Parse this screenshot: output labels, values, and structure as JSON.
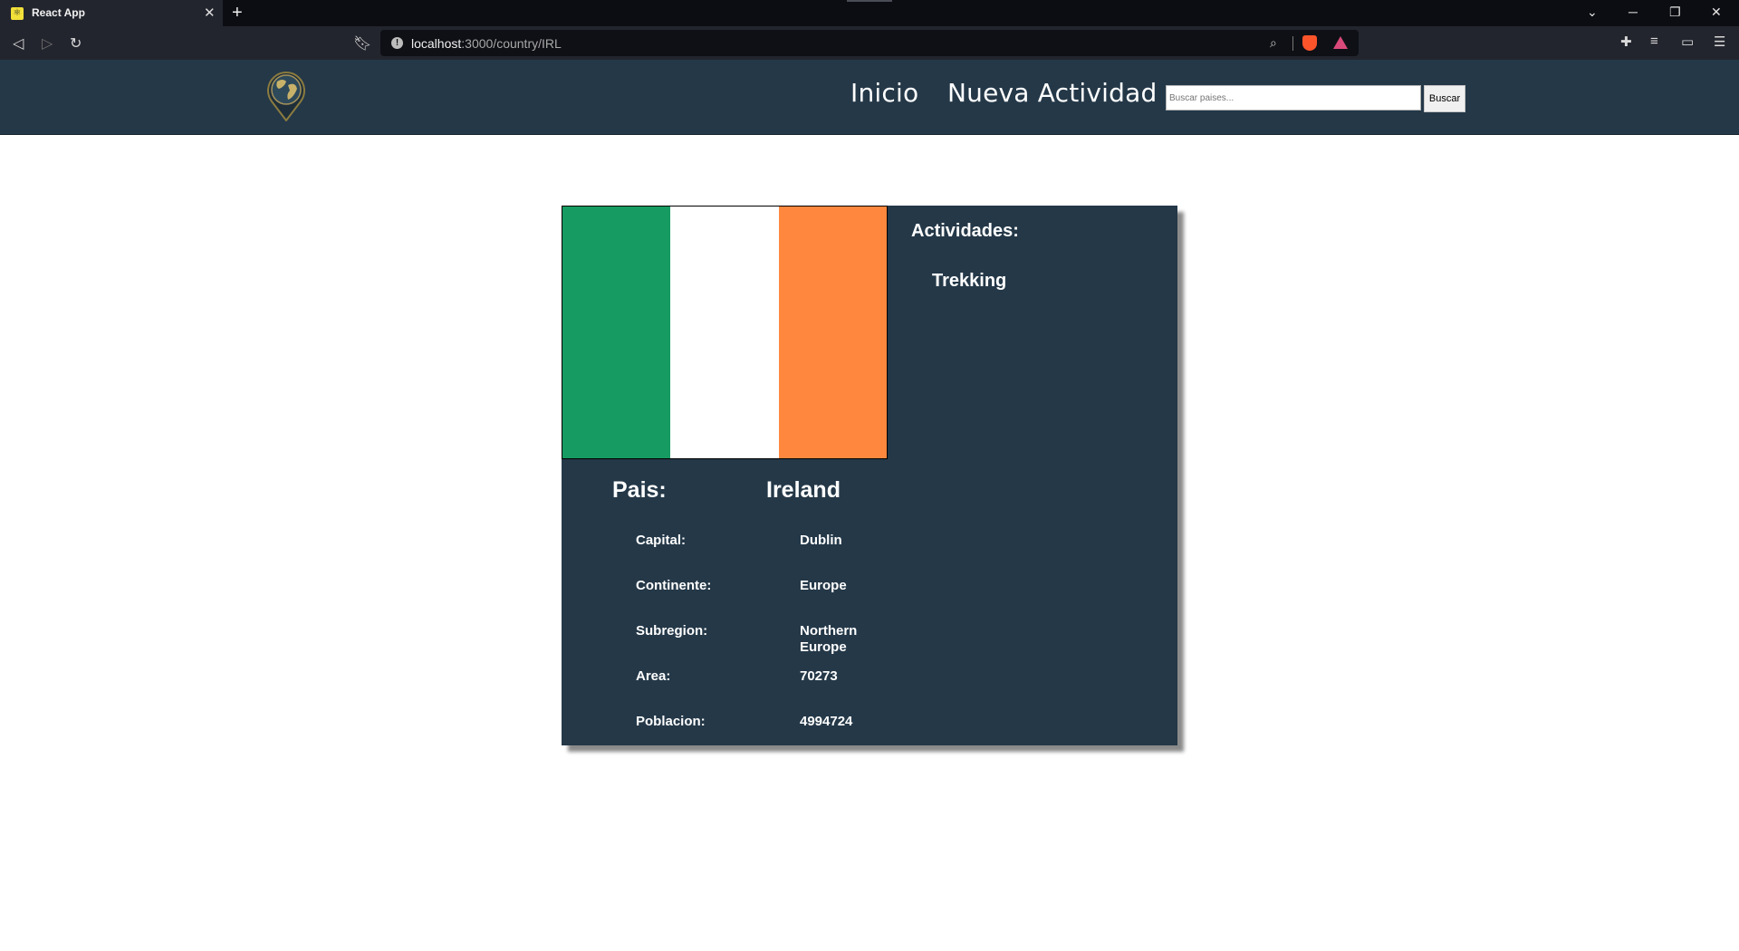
{
  "browser": {
    "tab_title": "React App",
    "url_host": "localhost",
    "url_path": ":3000/country/IRL"
  },
  "navbar": {
    "links": [
      "Inicio",
      "Nueva Actividad"
    ],
    "search_placeholder": "Buscar paises...",
    "search_button": "Buscar"
  },
  "country": {
    "pais_label": "Pais:",
    "name": "Ireland",
    "flag_colors": [
      "#169b62",
      "#ffffff",
      "#ff883e"
    ],
    "rows": [
      {
        "label": "Capital:",
        "value": "Dublin"
      },
      {
        "label": "Continente:",
        "value": "Europe"
      },
      {
        "label": "Subregion:",
        "value": "Northern Europe"
      },
      {
        "label": "Area:",
        "value": "70273"
      },
      {
        "label": "Poblacion:",
        "value": "4994724"
      }
    ]
  },
  "activities": {
    "title": "Actividades:",
    "items": [
      "Trekking"
    ]
  },
  "icons": {
    "logo": "globe-pin-icon"
  }
}
